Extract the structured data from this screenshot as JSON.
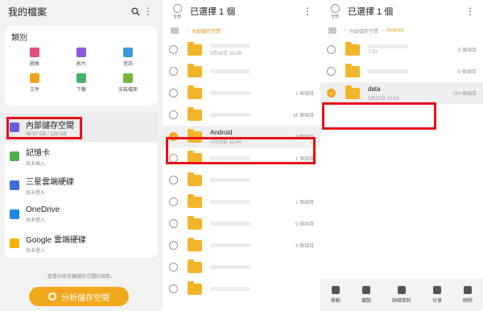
{
  "panel1": {
    "title": "我的檔案",
    "categories_title": "類別",
    "categories": [
      {
        "label": "圖像",
        "icon": "image-icon",
        "color": "#e14e7e"
      },
      {
        "label": "影片",
        "icon": "video-icon",
        "color": "#8a5be0"
      },
      {
        "label": "音訊",
        "icon": "music-icon",
        "color": "#3a9ad9"
      },
      {
        "label": "文件",
        "icon": "document-icon",
        "color": "#f0a320"
      },
      {
        "label": "下載",
        "icon": "download-icon",
        "color": "#47b06a"
      },
      {
        "label": "安裝檔案",
        "icon": "apk-icon",
        "color": "#7ab83a"
      }
    ],
    "storage": [
      {
        "name": "內部儲存空間",
        "sub": "48.97 GB / 128 GB",
        "icon": "phone-icon",
        "color": "#6a5be0"
      },
      {
        "name": "記憶卡",
        "sub": "尚未插入",
        "icon": "sd-card-icon",
        "color": "#4caf50"
      },
      {
        "name": "三星雲端硬碟",
        "sub": "尚未登入",
        "icon": "cloud-icon",
        "color": "#3d6fd8"
      },
      {
        "name": "OneDrive",
        "sub": "尚未登入",
        "icon": "onedrive-icon",
        "color": "#1e88e5"
      },
      {
        "name": "Google 雲端硬碟",
        "sub": "尚未登入",
        "icon": "google-drive-icon",
        "color": "#f4b400"
      }
    ],
    "footer_note": "查看佔用手機儲存空間的項目。",
    "analyze_button": "分析儲存空間"
  },
  "panel2": {
    "title": "已選擇 1 個",
    "select_all": "全部",
    "crumb": "內部儲存空間",
    "rows": [
      {
        "name": "",
        "date": "1月18日 20:28",
        "count": "",
        "checked": false
      },
      {
        "name": "",
        "date": "",
        "count": "",
        "checked": false
      },
      {
        "name": "",
        "date": "",
        "count": "1 個項目",
        "checked": false
      },
      {
        "name": "",
        "date": "",
        "count": "16 個項目",
        "checked": false
      },
      {
        "name": "Android",
        "date": "2月28日 12:44",
        "count": "3 個項目",
        "checked": true
      },
      {
        "name": "",
        "date": "",
        "count": "1 個項目",
        "checked": false
      },
      {
        "name": "",
        "date": "",
        "count": "",
        "checked": false
      },
      {
        "name": "",
        "date": "",
        "count": "1 個項目",
        "checked": false
      },
      {
        "name": "",
        "date": "",
        "count": "5 個項目",
        "checked": false
      },
      {
        "name": "",
        "date": "",
        "count": "4 個項目",
        "checked": false
      },
      {
        "name": "",
        "date": "",
        "count": "",
        "checked": false
      },
      {
        "name": "",
        "date": "",
        "count": "",
        "checked": false
      }
    ]
  },
  "panel3": {
    "title": "已選擇 1 個",
    "select_all": "全部",
    "crumb_root": "內部儲存空間",
    "crumb_current": "Android",
    "rows": [
      {
        "name": "",
        "date": "7:33",
        "count": "8 個項目",
        "checked": false
      },
      {
        "name": "",
        "date": "",
        "count": "9 個項目",
        "checked": false
      },
      {
        "name": "data",
        "date": "3月25日 03:04",
        "count": "154 個項目",
        "checked": true
      }
    ],
    "actions": [
      {
        "label": "移動",
        "icon": "move-icon"
      },
      {
        "label": "複製",
        "icon": "copy-icon"
      },
      {
        "label": "詳細資料",
        "icon": "info-icon"
      },
      {
        "label": "分享",
        "icon": "share-icon"
      },
      {
        "label": "刪除",
        "icon": "delete-icon"
      }
    ]
  }
}
